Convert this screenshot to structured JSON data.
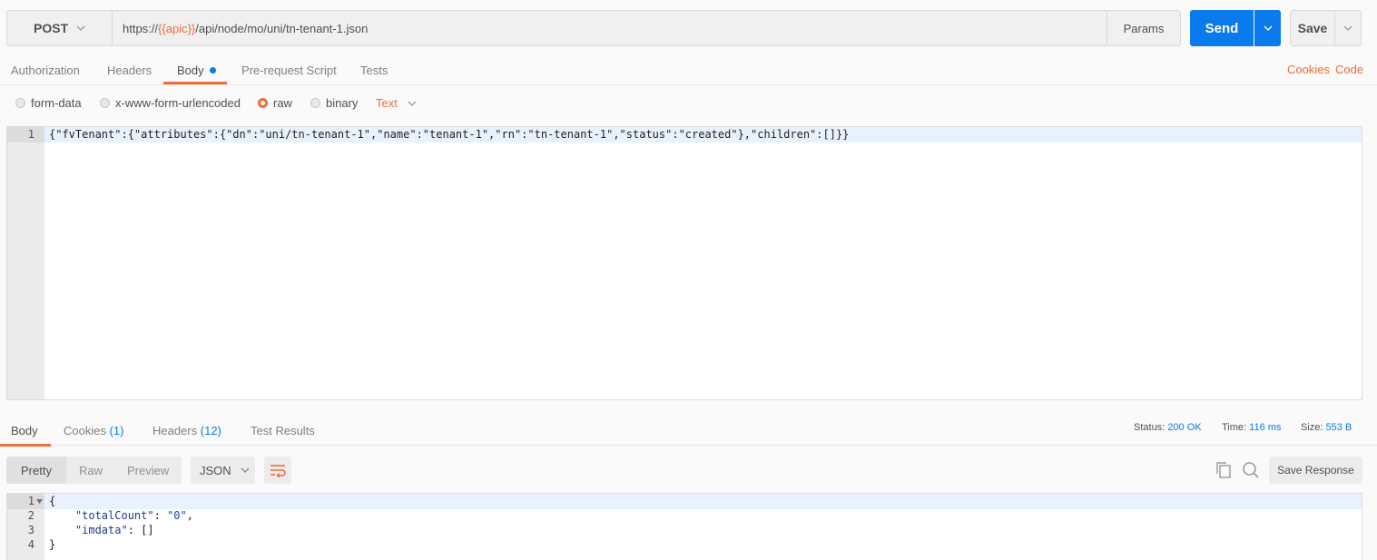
{
  "request": {
    "method": "POST",
    "url_prefix": "https://",
    "url_variable": "{{apic}}",
    "url_suffix": "/api/node/mo/uni/tn-tenant-1.json",
    "params_label": "Params",
    "send_label": "Send",
    "save_label": "Save"
  },
  "request_tabs": {
    "authorization": "Authorization",
    "headers": "Headers",
    "body": "Body",
    "pre_request": "Pre-request Script",
    "tests": "Tests",
    "cookies_link": "Cookies",
    "code_link": "Code"
  },
  "body_types": {
    "form_data": "form-data",
    "urlencoded": "x-www-form-urlencoded",
    "raw": "raw",
    "binary": "binary",
    "selected": "raw",
    "raw_format": "Text"
  },
  "request_body": {
    "line_number": "1",
    "content": "{\"fvTenant\":{\"attributes\":{\"dn\":\"uni/tn-tenant-1\",\"name\":\"tenant-1\",\"rn\":\"tn-tenant-1\",\"status\":\"created\"},\"children\":[]}}"
  },
  "response_tabs": {
    "body": "Body",
    "cookies": "Cookies",
    "cookies_count": "(1)",
    "headers": "Headers",
    "headers_count": "(12)",
    "test_results": "Test Results"
  },
  "response_meta": {
    "status_label": "Status:",
    "status_value": "200 OK",
    "time_label": "Time:",
    "time_value": "116 ms",
    "size_label": "Size:",
    "size_value": "553 B"
  },
  "response_toolbar": {
    "pretty": "Pretty",
    "raw": "Raw",
    "preview": "Preview",
    "format": "JSON",
    "save_response": "Save Response"
  },
  "response_body": {
    "lines": [
      {
        "n": "1",
        "text": "{"
      },
      {
        "n": "2",
        "key": "\"totalCount\"",
        "sep": ": ",
        "value": "\"0\"",
        "tail": ","
      },
      {
        "n": "3",
        "key": "\"imdata\"",
        "sep": ": ",
        "value": "[]",
        "tail": ""
      },
      {
        "n": "4",
        "text": "}"
      }
    ]
  },
  "colors": {
    "accent_orange": "#f26b3a",
    "send_blue": "#097bed",
    "status_blue": "#097bed"
  }
}
